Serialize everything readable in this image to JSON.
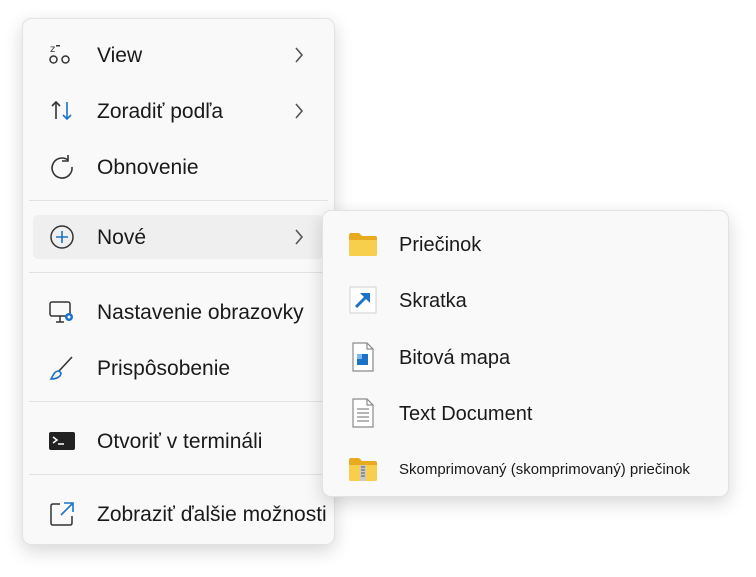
{
  "context_menu": {
    "items": [
      {
        "label": "View",
        "icon": "view-icon",
        "has_submenu": true
      },
      {
        "label": "Zoradiť podľa",
        "icon": "sort-icon",
        "has_submenu": true
      },
      {
        "label": "Obnovenie",
        "icon": "refresh-icon",
        "has_submenu": false
      },
      {
        "label": "Nové",
        "icon": "new-icon",
        "has_submenu": true
      },
      {
        "label": "Nastavenie obrazovky",
        "icon": "display-settings-icon",
        "has_submenu": false
      },
      {
        "label": "Prispôsobenie",
        "icon": "brush-icon",
        "has_submenu": false
      },
      {
        "label": "Otvoriť v termináli",
        "icon": "terminal-icon",
        "has_submenu": false
      },
      {
        "label": "Zobraziť ďalšie možnosti",
        "icon": "more-options-icon",
        "has_submenu": false
      }
    ]
  },
  "new_submenu": {
    "items": [
      {
        "label": "Priečinok",
        "icon": "folder-icon"
      },
      {
        "label": "Skratka",
        "icon": "shortcut-icon"
      },
      {
        "label": "Bitová mapa",
        "icon": "bitmap-icon"
      },
      {
        "label": "Text Document",
        "icon": "text-document-icon"
      },
      {
        "label": "Skomprimovaný (skomprimovaný) priečinok",
        "icon": "zip-folder-icon"
      }
    ]
  },
  "colors": {
    "accent": "#1a73c9",
    "menu_bg": "#f9f9f9",
    "hover_bg": "#efefef",
    "folder": "#f4c542"
  }
}
